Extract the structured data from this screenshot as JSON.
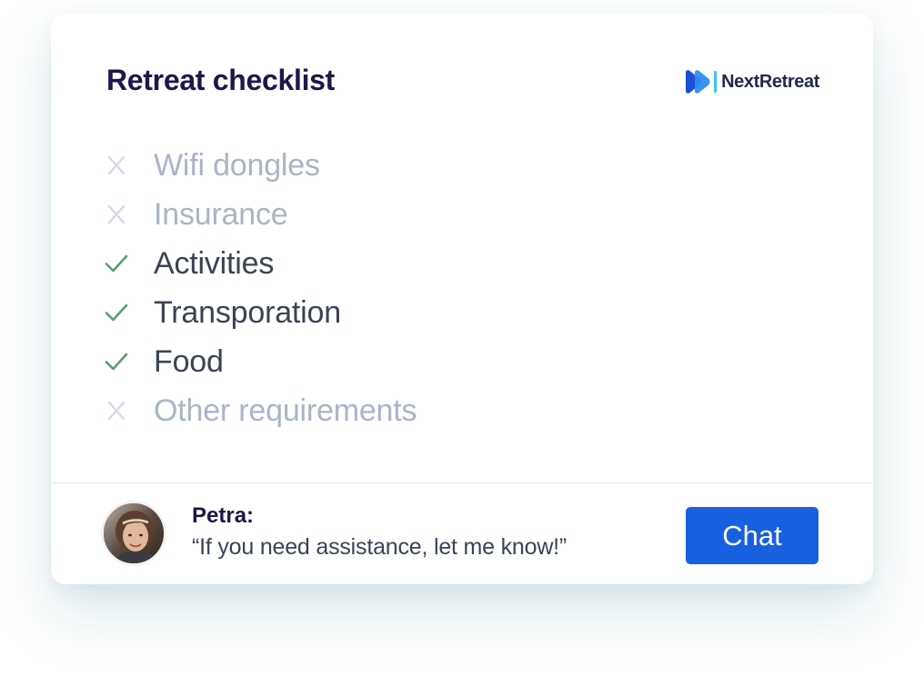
{
  "card": {
    "title": "Retreat checklist",
    "brand": {
      "name": "NextRetreat",
      "logo_icon": "next-retreat-logo-icon",
      "colors": [
        "#1a4fd6",
        "#2f8cf0",
        "#3ec5f5"
      ]
    }
  },
  "checklist": {
    "items": [
      {
        "label": "Wifi dongles",
        "done": false
      },
      {
        "label": "Insurance",
        "done": false
      },
      {
        "label": "Activities",
        "done": true
      },
      {
        "label": "Transporation",
        "done": true
      },
      {
        "label": "Food",
        "done": true
      },
      {
        "label": "Other requirements",
        "done": false
      }
    ],
    "icons": {
      "done": "check-icon",
      "todo": "cross-icon"
    },
    "colors": {
      "check": "#5a9e6b",
      "cross": "#d4dae5",
      "done_text": "#3a4356",
      "todo_text": "#a9b4c8"
    }
  },
  "contact": {
    "name": "Petra:",
    "message": "“If you need assistance, let me know!”",
    "avatar_icon": "avatar-photo"
  },
  "chat_button": {
    "label": "Chat",
    "color": "#1860e0"
  }
}
